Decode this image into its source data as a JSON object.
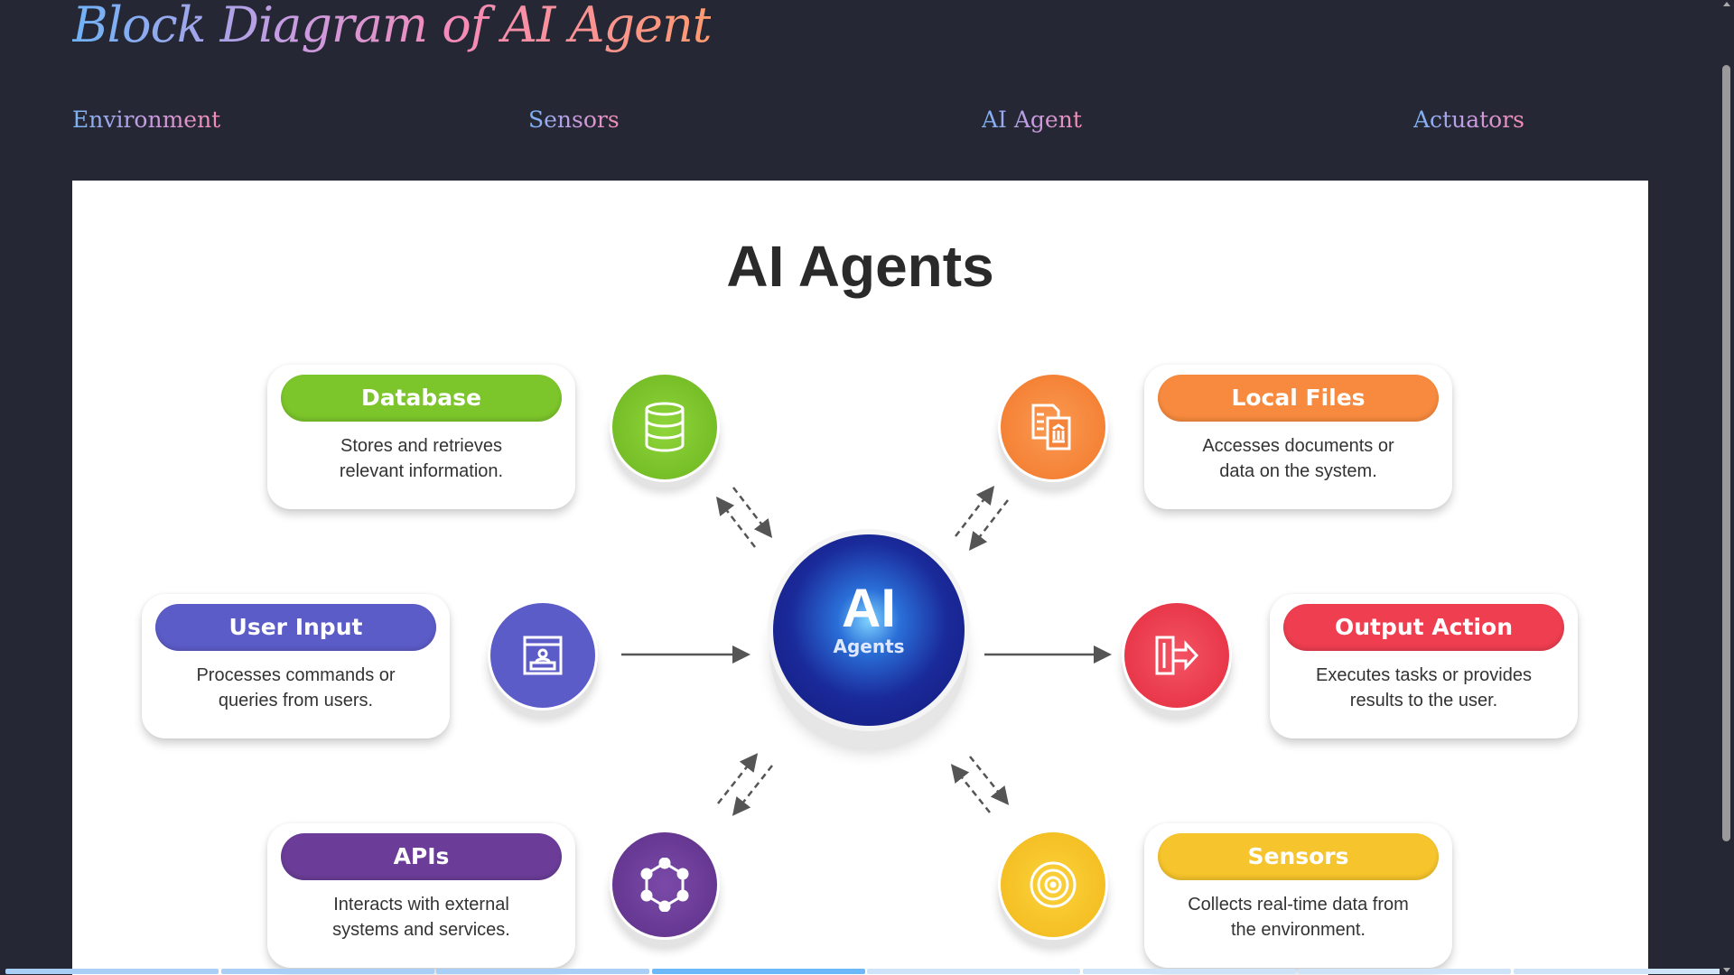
{
  "page_title": "Block Diagram of AI Agent",
  "nav": [
    "Environment",
    "Sensors",
    "AI Agent",
    "Actuators"
  ],
  "diagram": {
    "title": "AI Agents",
    "center": {
      "main": "AI",
      "sub": "Agents"
    },
    "blocks": [
      {
        "label": "Database",
        "desc1": "Stores and retrieves",
        "desc2": "relevant information.",
        "color": "#7cc52b",
        "icon": "database-icon"
      },
      {
        "label": "Local Files",
        "desc1": "Accesses documents or",
        "desc2": "data on the system.",
        "color": "#f78a3e",
        "icon": "documents-icon"
      },
      {
        "label": "User Input",
        "desc1": "Processes commands or",
        "desc2": "queries from users.",
        "color": "#5c5cc9",
        "icon": "user-window-icon"
      },
      {
        "label": "Output Action",
        "desc1": "Executes tasks or provides",
        "desc2": "results to the user.",
        "color": "#ee3e50",
        "icon": "exit-arrow-icon"
      },
      {
        "label": "APIs",
        "desc1": "Interacts with external",
        "desc2": "systems and services.",
        "color": "#6b3d98",
        "icon": "hexagon-network-icon"
      },
      {
        "label": "Sensors",
        "desc1": "Collects real-time data from",
        "desc2": "the environment.",
        "color": "#f6c42c",
        "icon": "radar-icon"
      }
    ]
  },
  "carousel": {
    "total": 8,
    "active_index": 3
  }
}
